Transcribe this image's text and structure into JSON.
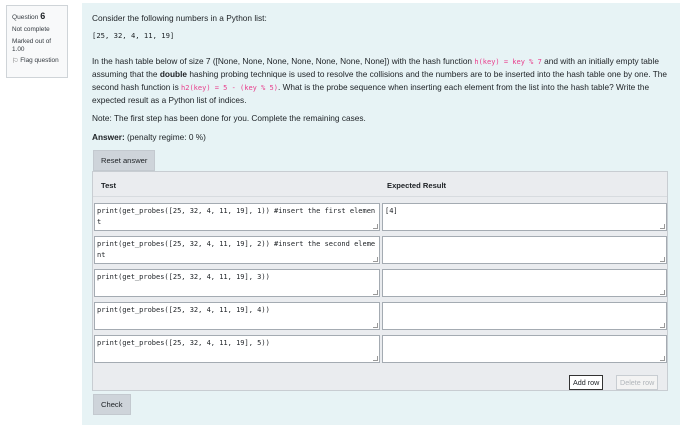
{
  "question_info": {
    "label": "Question",
    "number": "6",
    "state": "Not complete",
    "marked": "Marked out of 1.00",
    "flag_label": "Flag question"
  },
  "question": {
    "intro": "Consider the following numbers in a Python list:",
    "list_literal": "[25, 32, 4, 11, 19]",
    "desc_part1": "In the hash table below of size 7 ([None, None, None, None, None, None, None]) with the hash function ",
    "hash1_code": "h(key) = key % 7",
    "desc_part2": " and with an initially empty table assuming that the ",
    "desc_bold": "double",
    "desc_part3": " hashing probing technique is used to resolve the collisions and the numbers are to be inserted into the hash table one by one. The second hash function is ",
    "hash2_code": "h2(key) = 5 - (key % 5)",
    "desc_part4": ". What is the probe sequence when inserting each element from the list into the hash table? Write the expected result as a Python list of indices.",
    "note": "Note: The first step has been done for you. Complete the remaining cases."
  },
  "answer": {
    "label": "Answer:",
    "penalty": "(penalty regime: 0 %)",
    "reset_label": "Reset answer"
  },
  "table": {
    "headers": {
      "test": "Test",
      "expected": "Expected Result"
    },
    "rows": [
      {
        "test": "print(get_probes([25, 32, 4, 11, 19], 1)) #insert the first element",
        "expected": "[4]"
      },
      {
        "test": "print(get_probes([25, 32, 4, 11, 19], 2)) #insert the second element",
        "expected": ""
      },
      {
        "test": "print(get_probes([25, 32, 4, 11, 19], 3))",
        "expected": ""
      },
      {
        "test": "print(get_probes([25, 32, 4, 11, 19], 4))",
        "expected": ""
      },
      {
        "test": "print(get_probes([25, 32, 4, 11, 19], 5))",
        "expected": ""
      }
    ],
    "add_row_label": "Add row",
    "delete_row_label": "Delete row"
  },
  "check_label": "Check",
  "icons": {
    "flag": "flag-icon"
  },
  "colors": {
    "background": "#e7f3f5",
    "code": "#e83e8c",
    "button": "#ced4da"
  }
}
